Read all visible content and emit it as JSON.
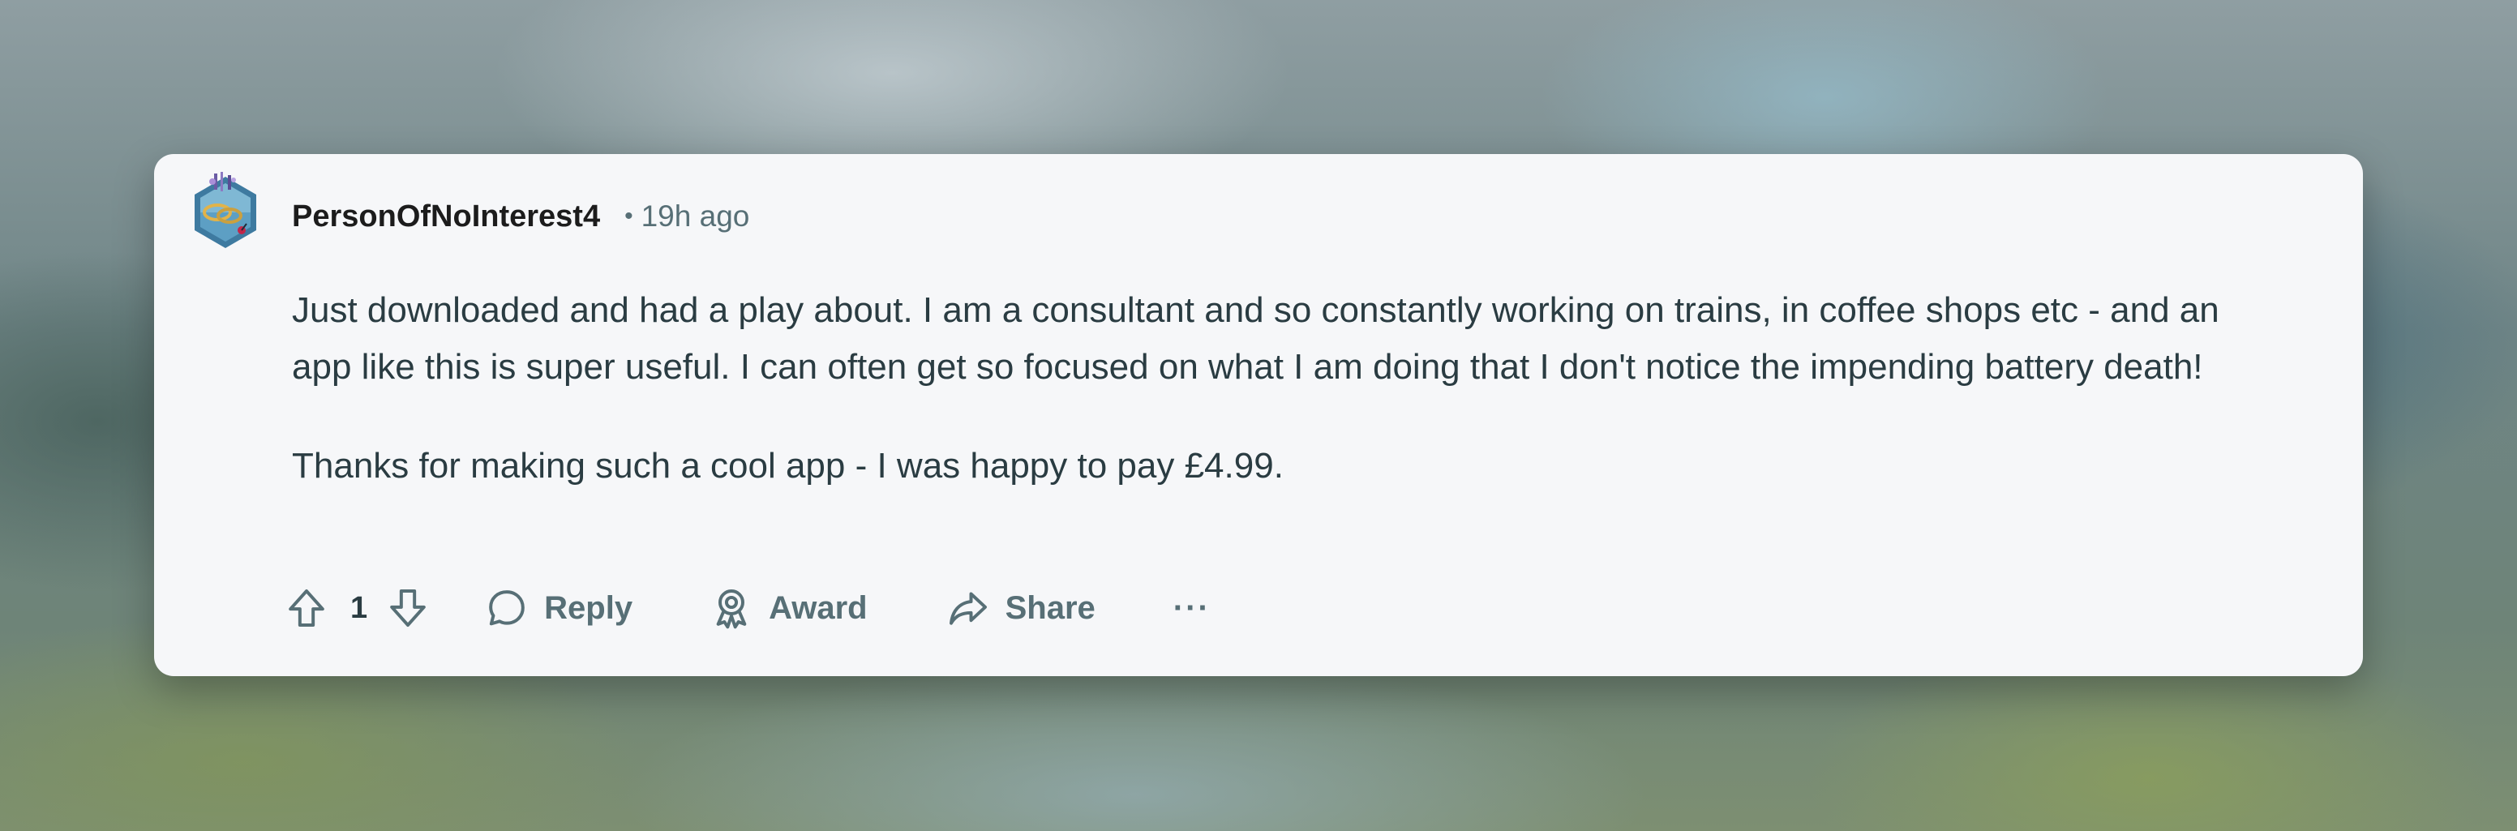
{
  "comment": {
    "username": "PersonOfNoInterest4",
    "separator": "•",
    "time": "19h ago",
    "paragraphs": [
      "Just downloaded and had a play about. I am a consultant and so constantly working on trains, in coffee shops etc - and an app like this is super useful. I can often get so focused on what I am doing that I don't notice the impending battery death!",
      "Thanks for making such a cool app - I was happy to pay £4.99."
    ]
  },
  "actions": {
    "vote_count": "1",
    "reply_label": "Reply",
    "award_label": "Award",
    "share_label": "Share",
    "more_label": "···"
  },
  "icons": {
    "avatar": "avatar-image",
    "upvote": "upvote-arrow-icon",
    "downvote": "downvote-arrow-icon",
    "reply": "speech-bubble-icon",
    "award": "award-ribbon-icon",
    "share": "share-arrow-icon",
    "more": "ellipsis-icon"
  },
  "colors": {
    "card_background": "#f6f7f9",
    "username": "#1c1c1c",
    "meta_text": "#576f76",
    "body_text": "#2a3c42"
  }
}
